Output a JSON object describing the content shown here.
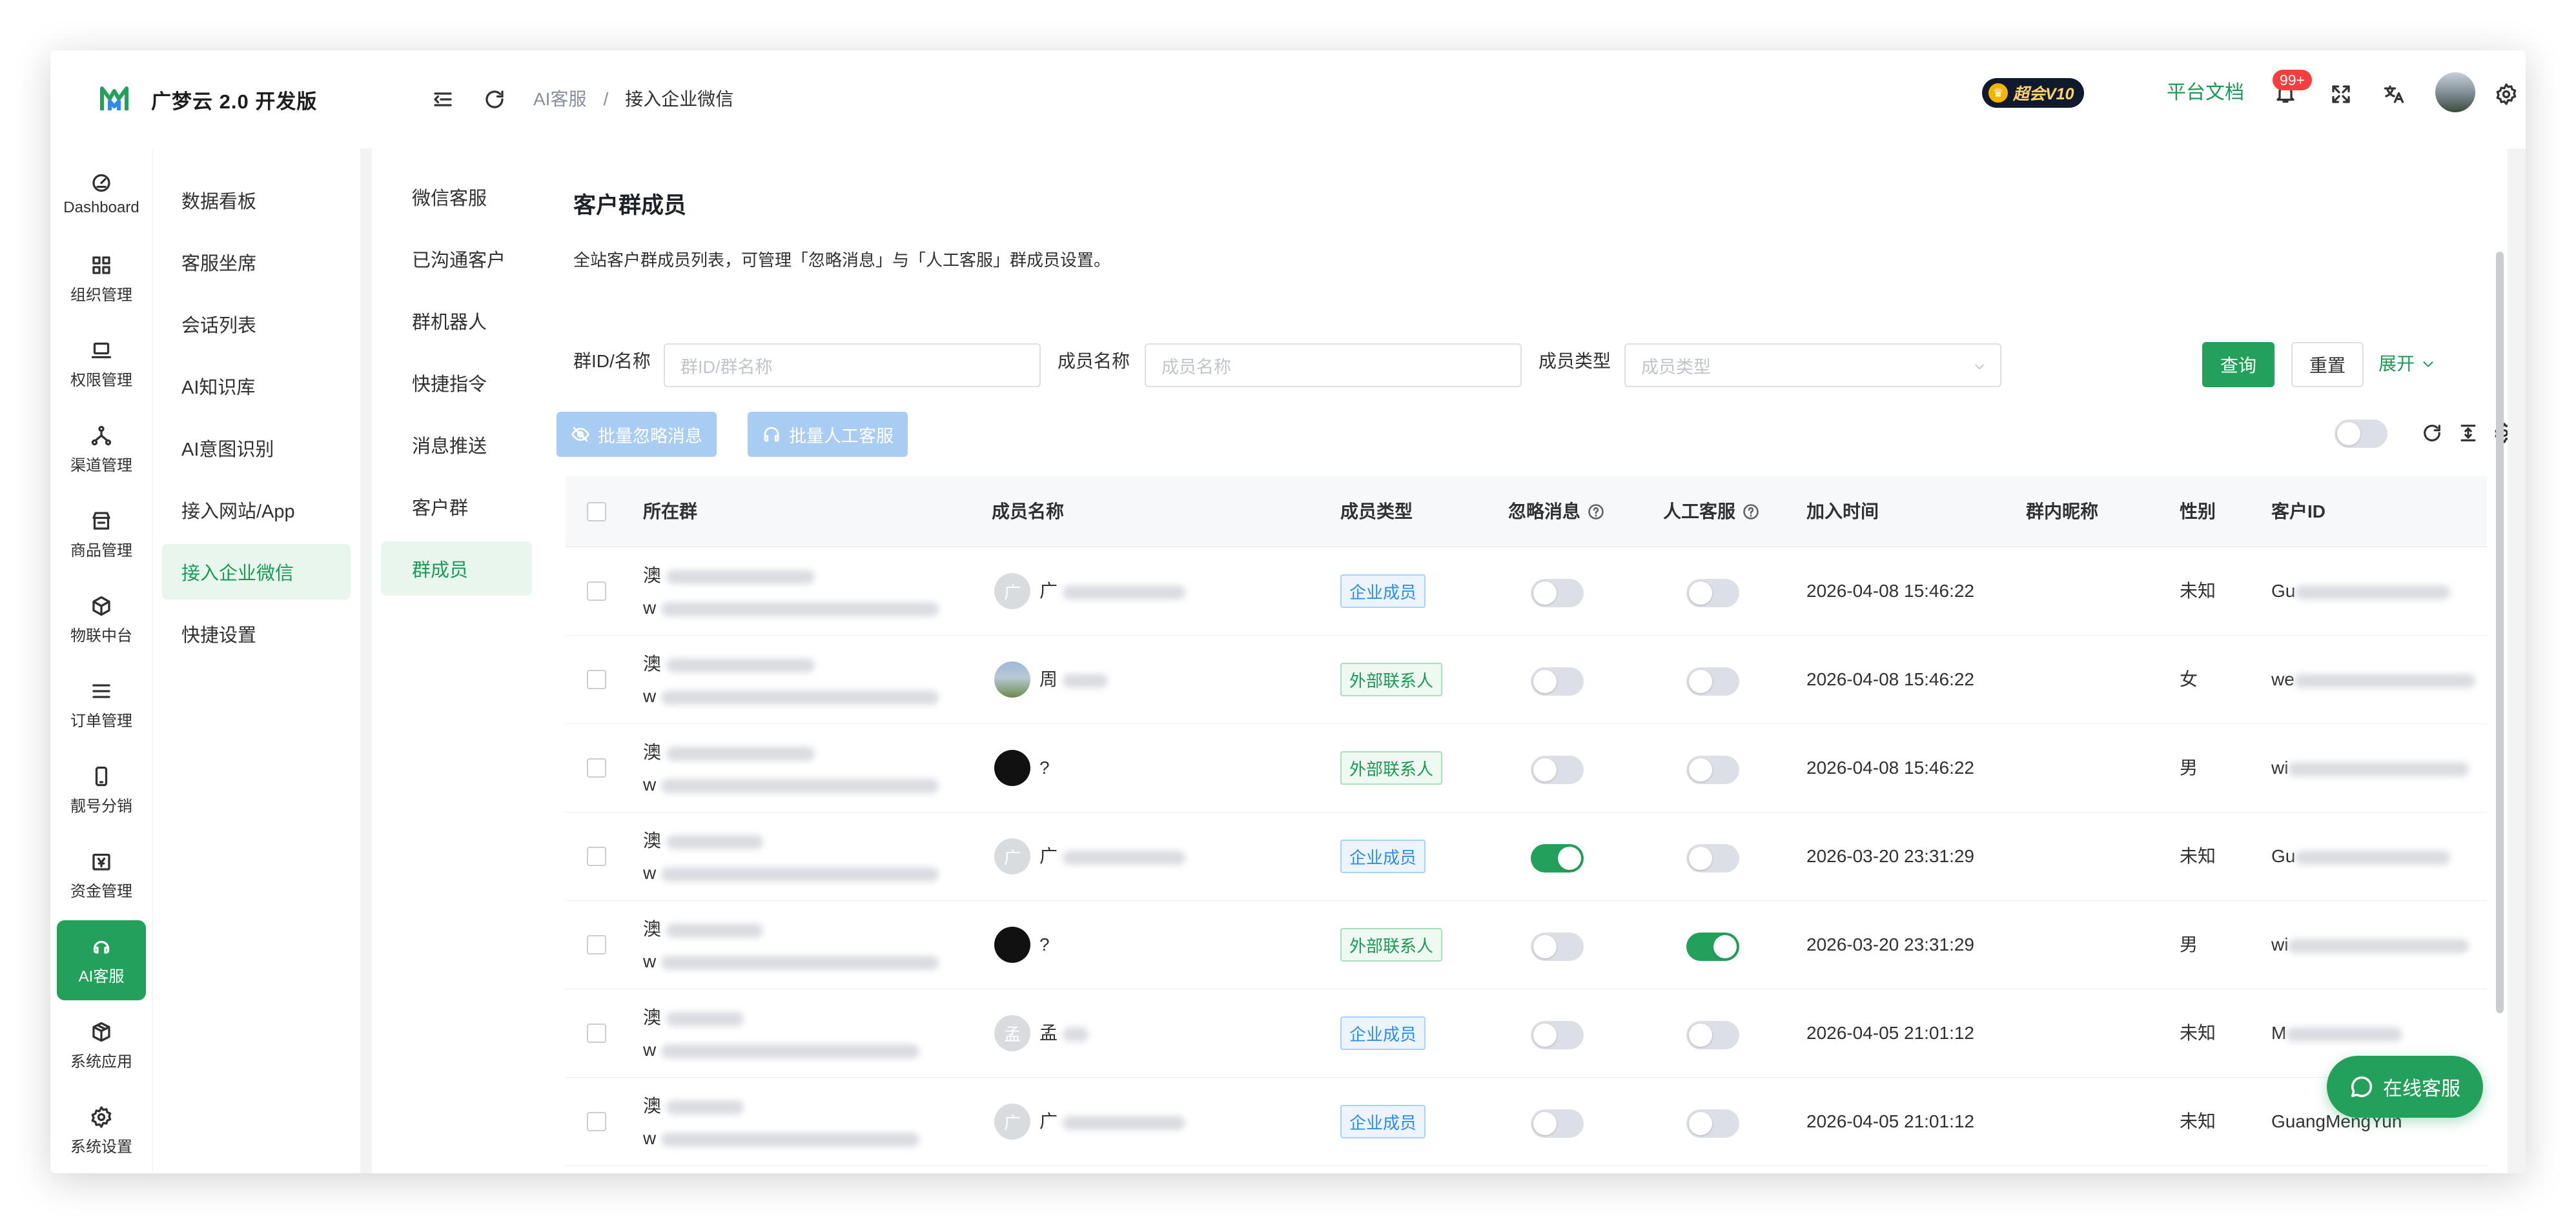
{
  "app": {
    "name": "广梦云 2.0 开发版",
    "brand_color": "#23a15b"
  },
  "header": {
    "breadcrumb": [
      "AI客服",
      "/",
      "接入企业微信"
    ],
    "vip_badge": "超会V10",
    "docs_link": "平台文档",
    "notification_count": "99+"
  },
  "rail": {
    "items": [
      {
        "label": "Dashboard",
        "icon": "dashboard-icon"
      },
      {
        "label": "组织管理",
        "icon": "grid-icon"
      },
      {
        "label": "权限管理",
        "icon": "laptop-icon"
      },
      {
        "label": "渠道管理",
        "icon": "network-icon"
      },
      {
        "label": "商品管理",
        "icon": "shop-icon"
      },
      {
        "label": "物联中台",
        "icon": "cube-icon"
      },
      {
        "label": "订单管理",
        "icon": "list-icon"
      },
      {
        "label": "靓号分销",
        "icon": "phone-icon"
      },
      {
        "label": "资金管理",
        "icon": "money-icon"
      },
      {
        "label": "AI客服",
        "icon": "ai-service-icon",
        "active": true
      },
      {
        "label": "系统应用",
        "icon": "package-icon"
      },
      {
        "label": "系统设置",
        "icon": "gear-icon"
      }
    ]
  },
  "menu2": {
    "items": [
      "数据看板",
      "客服坐席",
      "会话列表",
      "AI知识库",
      "AI意图识别",
      "接入网站/App",
      "接入企业微信",
      "快捷设置"
    ],
    "active_index": 6
  },
  "menu3": {
    "items": [
      "微信客服",
      "已沟通客户",
      "群机器人",
      "快捷指令",
      "消息推送",
      "客户群",
      "群成员"
    ],
    "active_index": 6
  },
  "page": {
    "title": "客户群成员",
    "description": "全站客户群成员列表，可管理「忽略消息」与「人工客服」群成员设置。"
  },
  "filters": {
    "group_label": "群ID/名称",
    "group_placeholder": "群ID/群名称",
    "member_label": "成员名称",
    "member_placeholder": "成员名称",
    "type_label": "成员类型",
    "type_placeholder": "成员类型",
    "query_label": "查询",
    "reset_label": "重置",
    "expand_label": "展开"
  },
  "actions": {
    "batch_ignore_label": "批量忽略消息",
    "batch_human_label": "批量人工客服"
  },
  "table": {
    "columns": [
      "所在群",
      "成员名称",
      "成员类型",
      "忽略消息",
      "人工客服",
      "加入时间",
      "群内昵称",
      "性别",
      "客户ID"
    ],
    "rows": [
      {
        "group_initial": "澳",
        "group_id_initial": "w",
        "avatar": "广",
        "avatar_style": "grey",
        "name_prefix": "广",
        "type": "企业成员",
        "type_color": "blue",
        "ignore": false,
        "human": false,
        "join_time": "2026-04-08 15:46:22",
        "gender": "未知",
        "cid_prefix": "Gu"
      },
      {
        "group_initial": "澳",
        "group_id_initial": "w",
        "avatar": "",
        "avatar_style": "photo",
        "name_prefix": "周",
        "type": "外部联系人",
        "type_color": "green",
        "ignore": false,
        "human": false,
        "join_time": "2026-04-08 15:46:22",
        "gender": "女",
        "cid_prefix": "we"
      },
      {
        "group_initial": "澳",
        "group_id_initial": "w",
        "avatar": "",
        "avatar_style": "dark",
        "name_prefix": "?",
        "type": "外部联系人",
        "type_color": "green",
        "ignore": false,
        "human": false,
        "join_time": "2026-04-08 15:46:22",
        "gender": "男",
        "cid_prefix": "wi"
      },
      {
        "group_initial": "澳",
        "group_id_initial": "w",
        "avatar": "广",
        "avatar_style": "grey",
        "name_prefix": "广",
        "type": "企业成员",
        "type_color": "blue",
        "ignore": true,
        "human": false,
        "join_time": "2026-03-20 23:31:29",
        "gender": "未知",
        "cid_prefix": "Gu"
      },
      {
        "group_initial": "澳",
        "group_id_initial": "w",
        "avatar": "",
        "avatar_style": "dark",
        "name_prefix": "?",
        "type": "外部联系人",
        "type_color": "green",
        "ignore": false,
        "human": true,
        "join_time": "2026-03-20 23:31:29",
        "gender": "男",
        "cid_prefix": "wi"
      },
      {
        "group_initial": "澳",
        "group_id_initial": "w",
        "avatar": "孟",
        "avatar_style": "grey",
        "name_prefix": "孟",
        "type": "企业成员",
        "type_color": "blue",
        "ignore": false,
        "human": false,
        "join_time": "2026-04-05 21:01:12",
        "gender": "未知",
        "cid_prefix": "M"
      },
      {
        "group_initial": "澳",
        "group_id_initial": "w",
        "avatar": "广",
        "avatar_style": "grey",
        "name_prefix": "广",
        "type": "企业成员",
        "type_color": "blue",
        "ignore": false,
        "human": false,
        "join_time": "2026-04-05 21:01:12",
        "gender": "未知",
        "cid_prefix": "GuangMengYun"
      }
    ]
  },
  "floating": {
    "online_service_label": "在线客服"
  }
}
